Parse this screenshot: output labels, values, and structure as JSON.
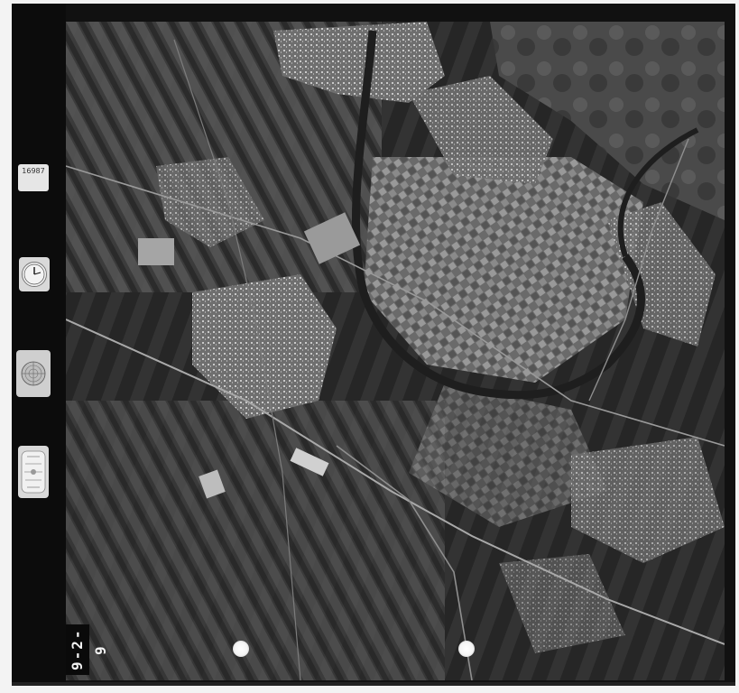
{
  "photo": {
    "frame_number": "9-2-9",
    "counter_text": "16987",
    "counter_subtext": "",
    "altimeter_top_text": "",
    "altimeter_bottom_text": ""
  },
  "colors": {
    "film_border": "#111111",
    "paper": "#f3f3f3",
    "fields_dark": "#2e2e2e",
    "fields_light": "#8a8a8a",
    "urban": "#b5b5b5"
  }
}
